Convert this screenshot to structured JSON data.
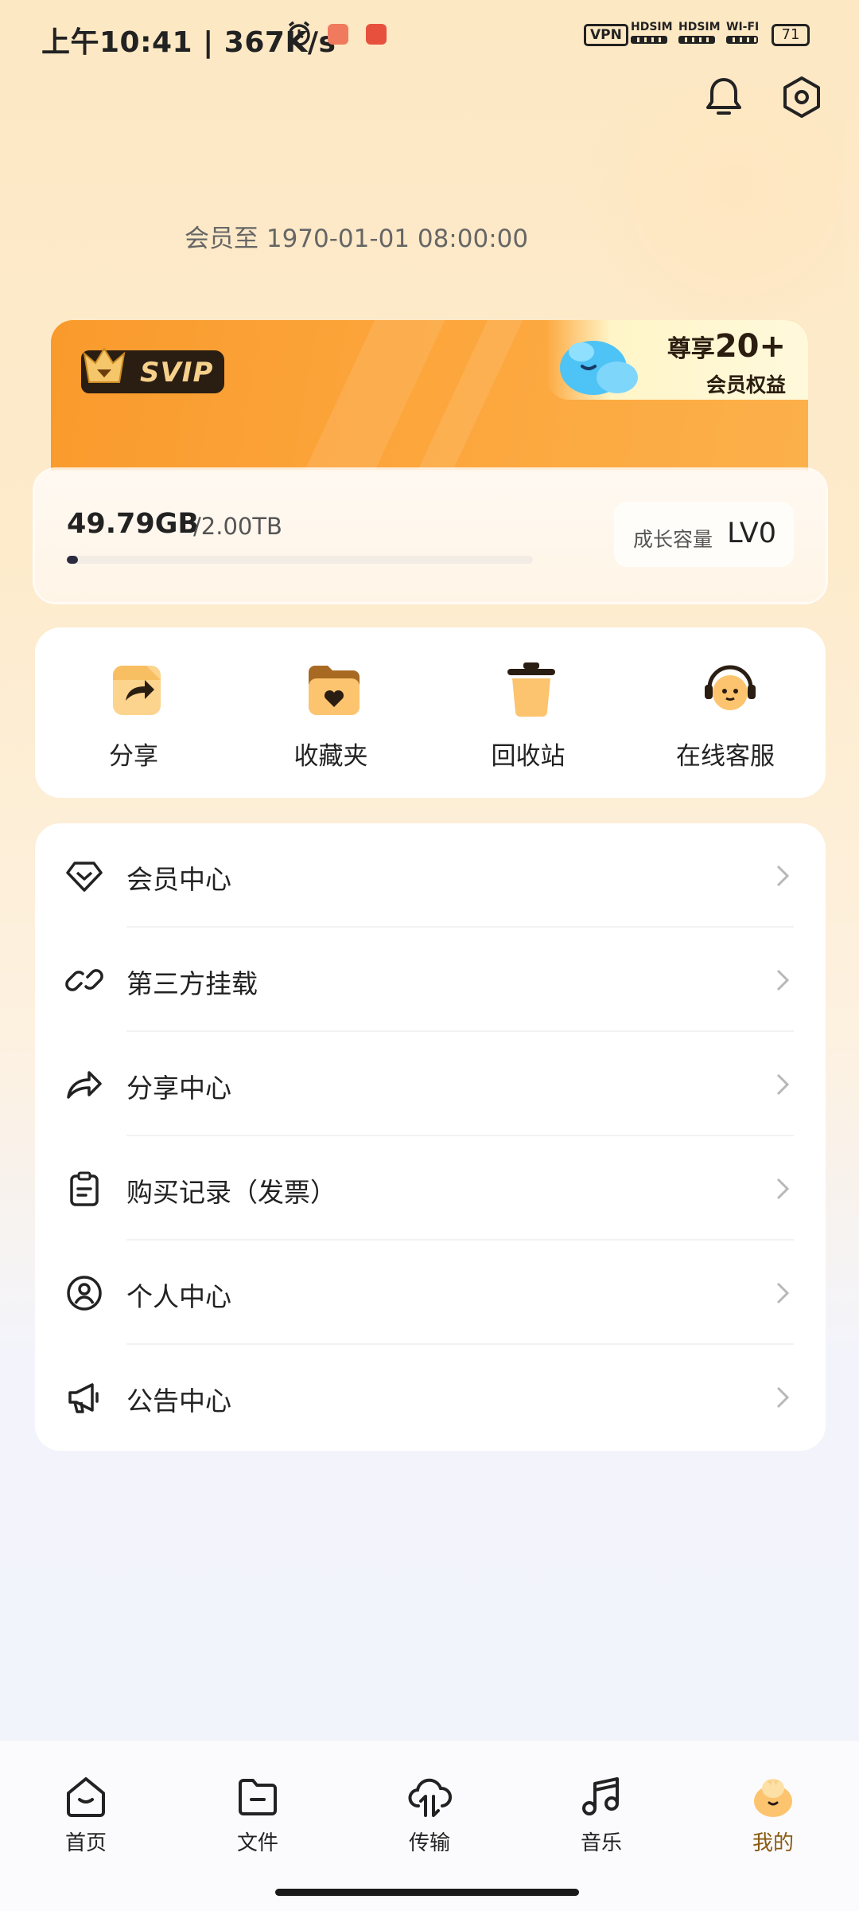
{
  "status_bar": {
    "time": "上午10:41 | 367K/s",
    "vpn": "VPN",
    "sim1": "HDSIM",
    "sim2": "HDSIM",
    "wifi": "WI-FI",
    "battery": "71"
  },
  "header": {
    "bell_icon": "bell-icon",
    "settings_icon": "settings-hex-icon"
  },
  "membership": {
    "expiry_text": "会员至 1970-01-01 08:00:00",
    "badge": "SVIP",
    "promo_line1_prefix": "尊享",
    "promo_line1_number": "20+",
    "promo_line2": "会员权益"
  },
  "storage": {
    "used": "49.79GB",
    "total": "/2.00TB",
    "used_fraction": 0.024,
    "growth_label": "成长容量",
    "growth_level": "LV0"
  },
  "quick_actions": [
    {
      "label": "分享",
      "icon": "share-icon"
    },
    {
      "label": "收藏夹",
      "icon": "favorites-folder-icon"
    },
    {
      "label": "回收站",
      "icon": "trash-icon"
    },
    {
      "label": "在线客服",
      "icon": "customer-service-icon"
    }
  ],
  "menu": [
    {
      "label": "会员中心",
      "icon": "diamond-icon"
    },
    {
      "label": "第三方挂载",
      "icon": "link-icon"
    },
    {
      "label": "分享中心",
      "icon": "share-arrow-icon"
    },
    {
      "label": "购买记录（发票）",
      "icon": "clipboard-icon"
    },
    {
      "label": "个人中心",
      "icon": "user-circle-icon"
    },
    {
      "label": "公告中心",
      "icon": "megaphone-icon"
    }
  ],
  "bottom_nav": [
    {
      "label": "首页",
      "icon": "home-icon"
    },
    {
      "label": "文件",
      "icon": "folder-icon"
    },
    {
      "label": "传输",
      "icon": "cloud-transfer-icon"
    },
    {
      "label": "音乐",
      "icon": "music-note-icon"
    },
    {
      "label": "我的",
      "icon": "avatar-icon",
      "active": true
    }
  ],
  "colors": {
    "accent_orange": "#f99a2c",
    "svip_gold": "#f6d18b",
    "active_tab": "#8a5a12"
  }
}
